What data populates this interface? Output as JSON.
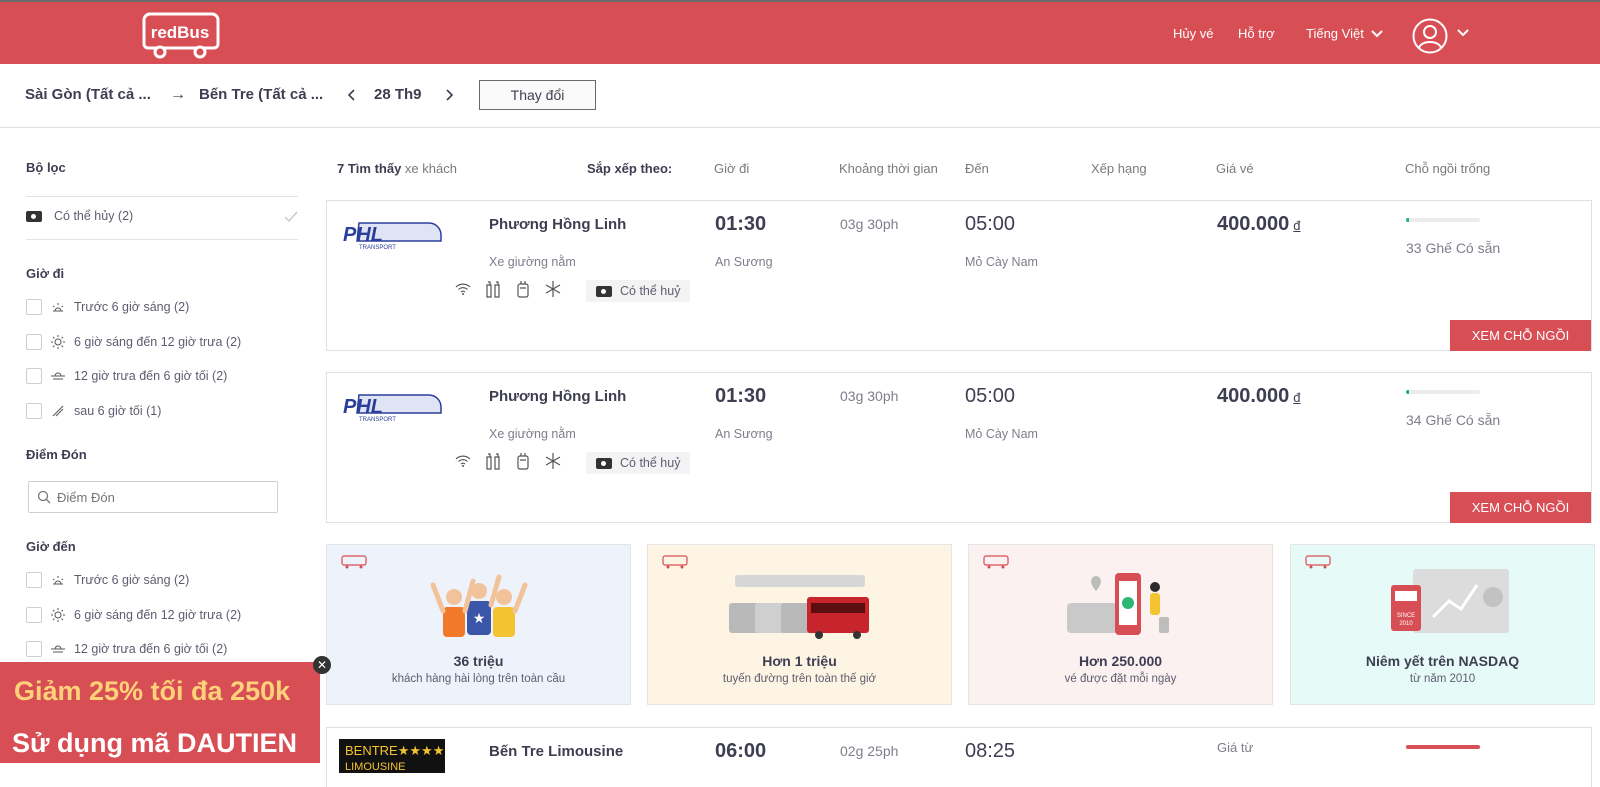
{
  "header": {
    "logo_text": "redBus",
    "cancel_ticket": "Hủy vé",
    "support": "Hỗ trợ",
    "language": "Tiếng Việt"
  },
  "search": {
    "from": "Sài Gòn (Tất cả ...",
    "to": "Bến Tre (Tất cả ...",
    "date": "28 Th9",
    "change_button": "Thay đổi"
  },
  "filters": {
    "title": "Bộ lọc",
    "cancellable": "Có thể hủy (2)",
    "departure_title": "Giờ đi",
    "departure_options": [
      "Trước 6 giờ sáng (2)",
      "6 giờ sáng đến 12 giờ trưa (2)",
      "12 giờ trưa đến 6 giờ tối (2)",
      "sau 6 giờ tối (1)"
    ],
    "pickup_title": "Điểm Đón",
    "pickup_placeholder": "Điểm Đón",
    "arrival_title": "Giờ đến",
    "arrival_options": [
      "Trước 6 giờ sáng (2)",
      "6 giờ sáng đến 12 giờ trưa (2)",
      "12 giờ trưa đến 6 giờ tối (2)"
    ]
  },
  "results_header": {
    "count": "7 Tìm thấy",
    "count_unit": "xe khách",
    "sort_label": "Sắp xếp theo:",
    "columns": [
      "Giờ đi",
      "Khoảng thời gian",
      "Đến",
      "Xếp hạng",
      "Giá vé",
      "Chỗ ngồi trống"
    ]
  },
  "buses": [
    {
      "operator": "Phương Hồng Linh",
      "bus_type": "Xe giường nằm",
      "cancel_tag": "Có thể huỷ",
      "departure_time": "01:30",
      "departure_place": "An Sương",
      "duration": "03g 30ph",
      "arrival_time": "05:00",
      "arrival_place": "Mỏ Cày Nam",
      "price": "400.000",
      "currency": "đ",
      "seats": "33 Ghế Có sẵn",
      "seat_fill_fraction": 0.04,
      "button": "XEM CHỖ NGỒI"
    },
    {
      "operator": "Phương Hồng Linh",
      "bus_type": "Xe giường nằm",
      "cancel_tag": "Có thể huỷ",
      "departure_time": "01:30",
      "departure_place": "An Sương",
      "duration": "03g 30ph",
      "arrival_time": "05:00",
      "arrival_place": "Mỏ Cày Nam",
      "price": "400.000",
      "currency": "đ",
      "seats": "34 Ghế Có sẵn",
      "seat_fill_fraction": 0.04,
      "button": "XEM CHỖ NGỒI"
    },
    {
      "operator": "Bến Tre Limousine",
      "departure_time": "06:00",
      "duration": "02g 25ph",
      "arrival_time": "08:25",
      "price_from": "Giá từ"
    }
  ],
  "promos": [
    {
      "title": "36 triệu",
      "subtitle": "khách hàng hài lòng trên toàn cầu",
      "bg": "#eef2fb"
    },
    {
      "title": "Hơn 1 triệu",
      "subtitle": "tuyến đường trên toàn thế giớ",
      "bg": "#fdf4e3"
    },
    {
      "title": "Hơn 250.000",
      "subtitle": "vé được đặt mỗi ngày",
      "bg": "#fbf1f1"
    },
    {
      "title": "Niêm yết trên NASDAQ",
      "subtitle": "từ năm 2010",
      "bg": "#e6fbf7"
    }
  ],
  "popup": {
    "line1": "Giảm 25% tối đa 250k",
    "line2": "Sử dụng mã DAUTIEN"
  },
  "colors": {
    "brand": "#d84e55",
    "seat_ok": "#1fb575"
  }
}
